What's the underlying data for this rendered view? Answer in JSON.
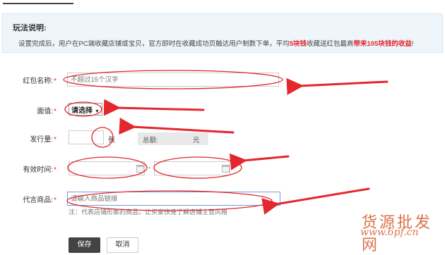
{
  "note": {
    "title": "玩法说明:",
    "text_a": "设置完成后，用户在PC端收藏店铺或宝贝，官方即时在收藏成功页触达用户制数下单，平均",
    "hl1": "5块钱",
    "text_b": "收藏送红包最高",
    "hl2": "带来105块钱的收益",
    "text_c": "!"
  },
  "form": {
    "name_label": "红包名称:",
    "name_placeholder": "不超过15个汉字",
    "face_label": "面值:",
    "face_select": "请选择",
    "qty_label": "发行量:",
    "qty_unit": "张",
    "total_label": "总额:",
    "total_unit": "元",
    "period_label": "有效时间:",
    "period_sep": "-",
    "product_label": "代言商品:",
    "product_placeholder": "请输入商品链接",
    "product_hint": "注：代表店铺形象的商品，让买家快速了解店铺主营风格",
    "required_star": "*"
  },
  "buttons": {
    "save": "保存",
    "cancel": "取消"
  },
  "watermark": {
    "text": "货源批发网",
    "url": "www.6pf.cn"
  },
  "colors": {
    "annotation": "#e4262d",
    "highlight": "#e4262d",
    "dark_button": "#434343",
    "note_bg": "#eef5fb",
    "watermark": "#d9734a"
  }
}
